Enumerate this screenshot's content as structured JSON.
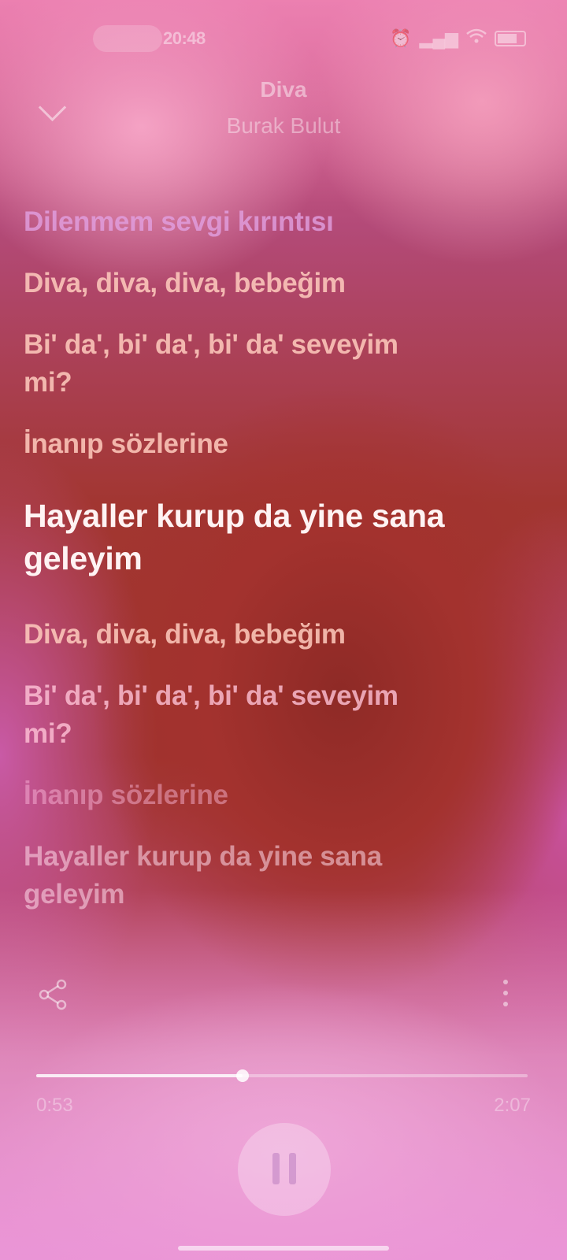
{
  "status_bar": {
    "time": "20:48",
    "battery_icon": "battery-icon",
    "wifi_icon": "wifi-icon",
    "signal_icon": "signal-icon",
    "alarm_icon": "alarm-icon"
  },
  "header": {
    "title": "Diva",
    "artist": "Burak Bulut",
    "collapse_icon": "chevron-down-icon"
  },
  "lyrics": [
    "Dilenmem sevgi kırıntısı",
    "Diva, diva, diva, bebeğim",
    "Bi' da', bi' da', bi' da' seveyim mi?",
    "İnanıp sözlerine",
    "Hayaller kurup da yine sana geleyim",
    "Diva, diva, diva, bebeğim",
    "Bi' da', bi' da', bi' da' seveyim mi?",
    "İnanıp sözlerine",
    "Hayaller kurup da yine sana geleyim"
  ],
  "active_line_index": 4,
  "player": {
    "current_time": "0:53",
    "total_time": "2:07",
    "progress_fraction": 0.42,
    "share_icon": "share-icon",
    "more_icon": "more-vertical-icon",
    "play_state_icon": "pause-icon"
  }
}
